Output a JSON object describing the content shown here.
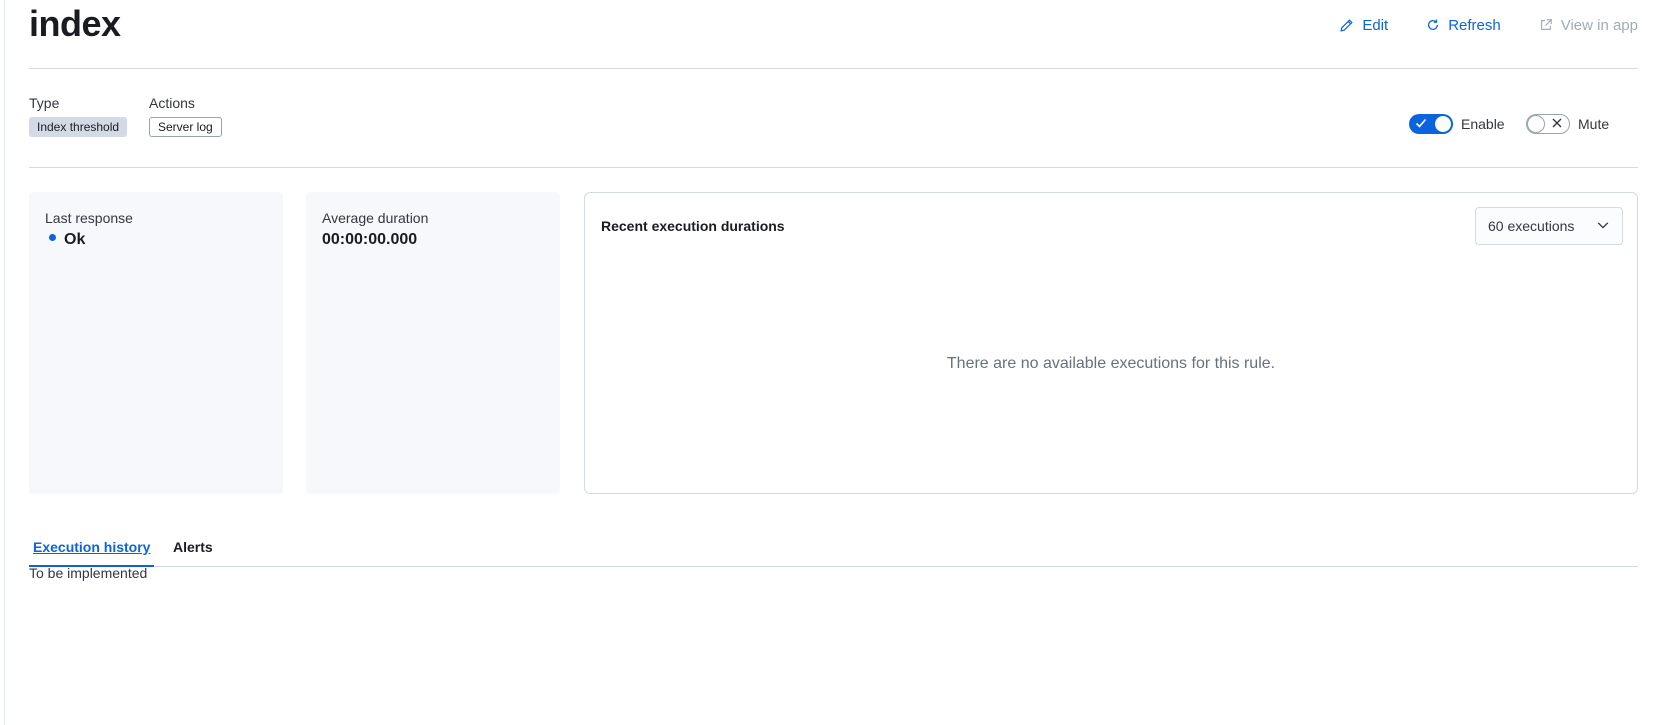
{
  "page": {
    "title": "index"
  },
  "header": {
    "edit_label": "Edit",
    "refresh_label": "Refresh",
    "view_in_app_label": "View in app"
  },
  "meta": {
    "type_label": "Type",
    "type_value": "Index threshold",
    "actions_label": "Actions",
    "actions_value": "Server log"
  },
  "toggles": {
    "enable_label": "Enable",
    "enable_state": true,
    "mute_label": "Mute",
    "mute_state": false
  },
  "stats": {
    "last_response_title": "Last response",
    "last_response_value": "Ok",
    "average_duration_title": "Average duration",
    "average_duration_value": "00:00:00.000"
  },
  "chart": {
    "title": "Recent execution durations",
    "select_value": "60 executions",
    "empty_message": "There are no available executions for this rule."
  },
  "tabs": {
    "items": [
      {
        "label": "Execution history",
        "active": true
      },
      {
        "label": "Alerts",
        "active": false
      }
    ],
    "content": "To be implemented"
  },
  "colors": {
    "accent": "#0b64dd",
    "disabled": "#a2abba",
    "panel_bg": "#f7f8fc",
    "border": "#d3dae6"
  },
  "icons": {
    "edit": "pencil-icon",
    "refresh": "refresh-icon",
    "view_in_app": "external-link-icon",
    "select": "chevron-down-icon"
  }
}
